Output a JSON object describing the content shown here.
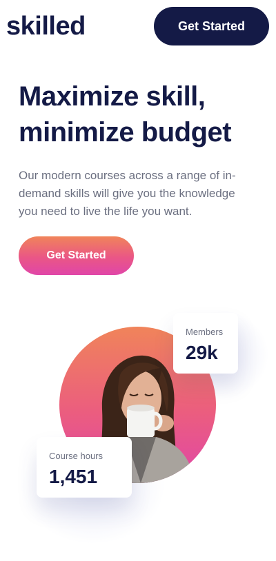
{
  "header": {
    "logo": "skilled",
    "cta_label": "Get Started"
  },
  "hero": {
    "title_line1": "Maximize skill,",
    "title_line2": "minimize budget",
    "description": "Our modern courses across a range of in-demand skills will give you the knowledge you need to live the life you want.",
    "cta_label": "Get Started"
  },
  "stats": {
    "members": {
      "label": "Members",
      "value": "29k"
    },
    "course_hours": {
      "label": "Course hours",
      "value": "1,451"
    }
  },
  "colors": {
    "navy": "#141a46",
    "gradient_start": "#f0845a",
    "gradient_end": "#e046a8",
    "body_text": "#6b6f80"
  }
}
